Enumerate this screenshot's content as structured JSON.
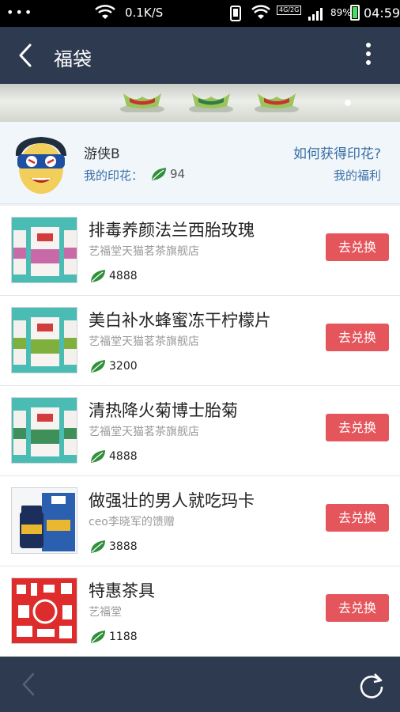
{
  "status_bar": {
    "dots": "•••",
    "speed": "0.1K/S",
    "network": "4G/2G",
    "battery": "89%",
    "time": "04:59"
  },
  "header": {
    "title": "福袋"
  },
  "user": {
    "name": "游侠B",
    "stamp_label": "我的印花：",
    "stamp_count": "94",
    "how_to_get": "如何获得印花?",
    "my_welfare": "我的福利"
  },
  "items": [
    {
      "name": "排毒养颜法兰西胎玫瑰",
      "store": "艺福堂天猫茗茶旗舰店",
      "price": "4888",
      "button": "去兑换",
      "thumb": "teal-cans-pink"
    },
    {
      "name": "美白补水蜂蜜冻干柠檬片",
      "store": "艺福堂天猫茗茶旗舰店",
      "price": "3200",
      "button": "去兑换",
      "thumb": "teal-cans-green"
    },
    {
      "name": "清热降火菊博士胎菊",
      "store": "艺福堂天猫茗茶旗舰店",
      "price": "4888",
      "button": "去兑换",
      "thumb": "teal-cans-green"
    },
    {
      "name": "做强壮的男人就吃玛卡",
      "store": "ceo李晓军的馈赠",
      "price": "3888",
      "button": "去兑换",
      "thumb": "maca-bottle-box"
    },
    {
      "name": "特惠茶具",
      "store": "艺福堂",
      "price": "1188",
      "button": "去兑换",
      "thumb": "red-tea-set"
    }
  ],
  "colors": {
    "header_bg": "#2e3a4f",
    "accent_blue": "#3a6fa6",
    "button_red": "#e5565c",
    "leaf_green": "#2f8f3a"
  }
}
